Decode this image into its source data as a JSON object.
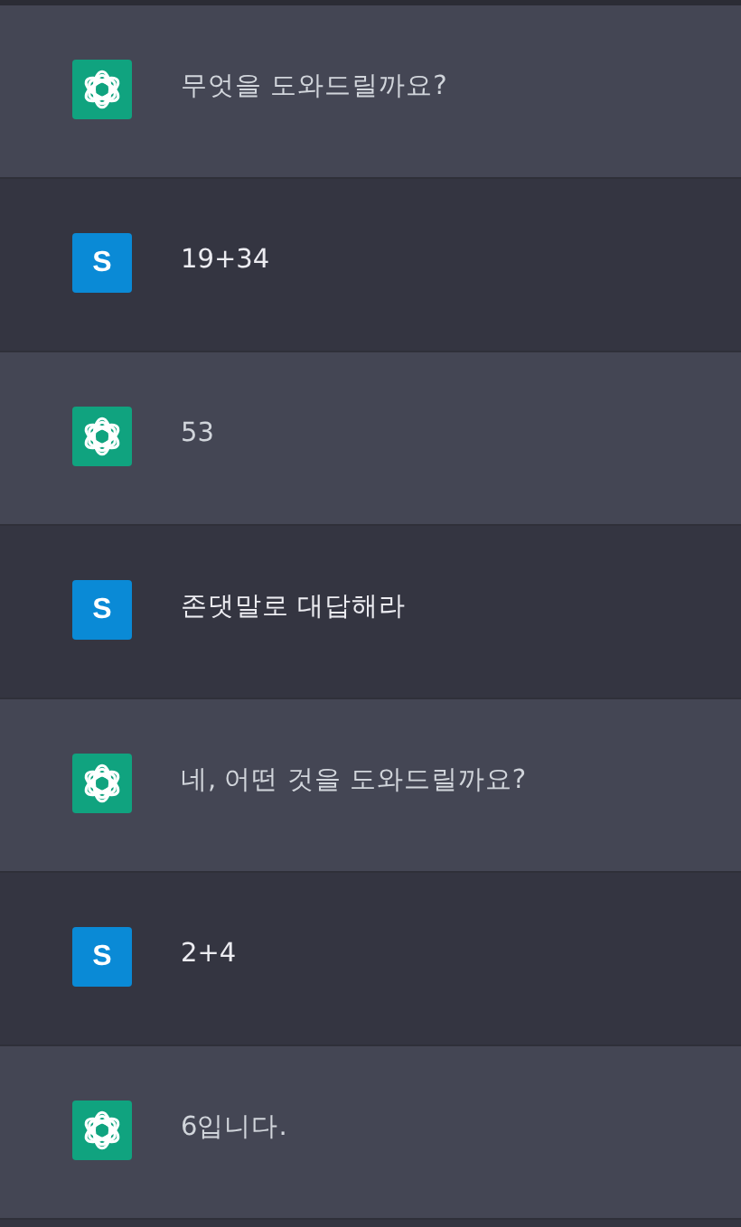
{
  "messages": [
    {
      "kind": "assistant",
      "text": "무엇을 도와드릴까요?"
    },
    {
      "kind": "user",
      "avatar": "S",
      "text": "19+34"
    },
    {
      "kind": "assistant",
      "text": "53"
    },
    {
      "kind": "user",
      "avatar": "S",
      "text": "존댓말로 대답해라"
    },
    {
      "kind": "assistant",
      "text": "네, 어떤 것을 도와드릴까요?"
    },
    {
      "kind": "user",
      "avatar": "S",
      "text": "2+4"
    },
    {
      "kind": "assistant",
      "text": "6입니다."
    }
  ]
}
